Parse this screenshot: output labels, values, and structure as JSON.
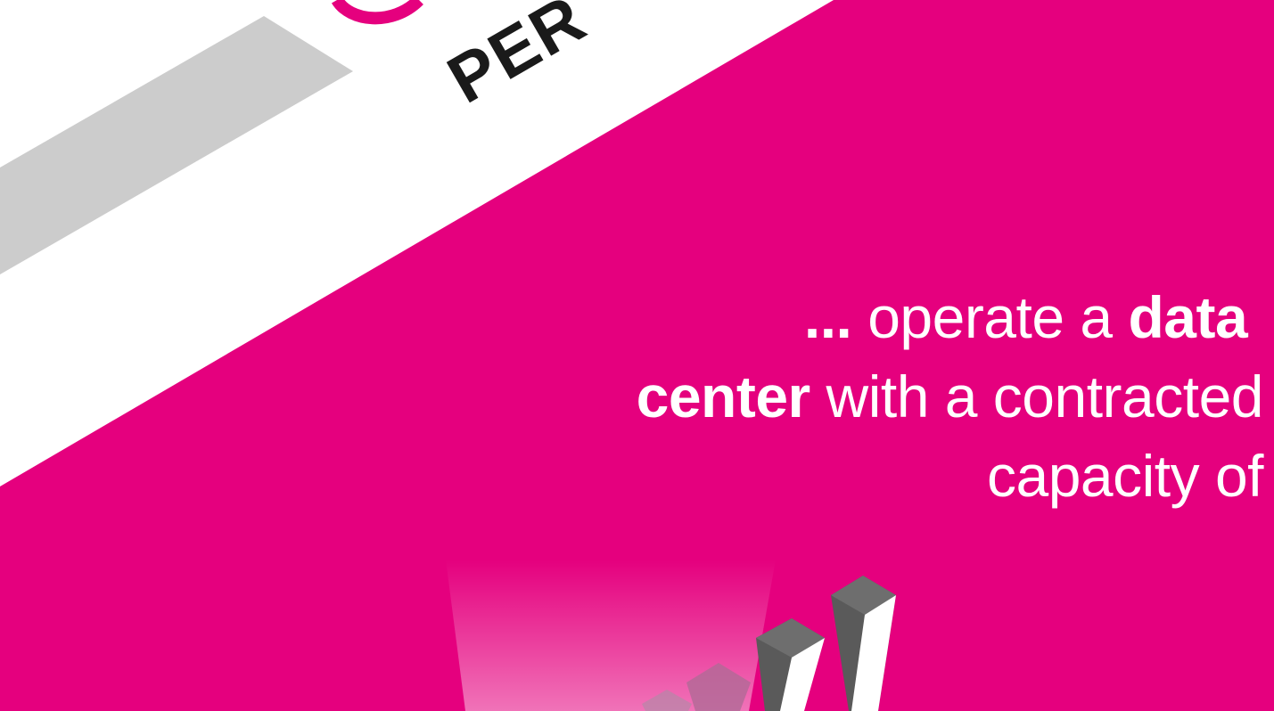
{
  "banner": {
    "visible_text": "PER",
    "accent_color": "#e5007e"
  },
  "headline": {
    "line1_prefix": "...",
    "line1_mid": " operate a ",
    "line1_bold": "data",
    "line2_bold": "center",
    "line2_rest": " with a contracted",
    "line3": "capacity of"
  },
  "graphic": {
    "name": "3d-letters-graphic",
    "description_color": "#5a5a5a"
  },
  "colors": {
    "background": "#e5007e",
    "banner_white": "#ffffff",
    "banner_grey": "#cccccc",
    "text_dark": "#1a1a1a"
  }
}
